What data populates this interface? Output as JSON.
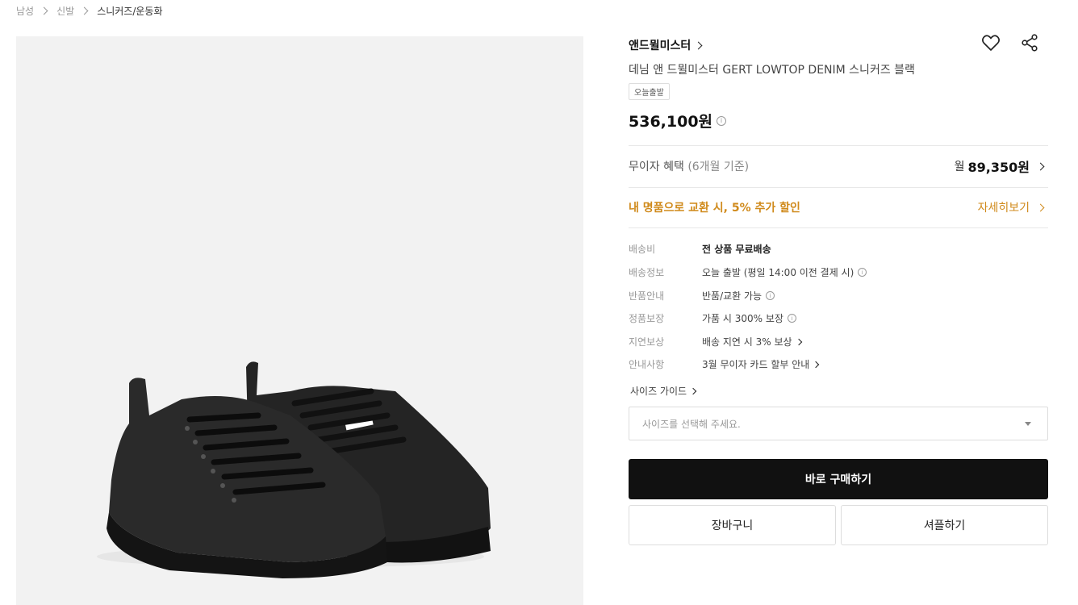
{
  "breadcrumb": {
    "items": [
      "남성",
      "신발",
      "스니커즈/운동화"
    ]
  },
  "product": {
    "brand": "앤드뮐미스터",
    "name": "데님 앤 드뮐미스터 GERT LOWTOP DENIM 스니커즈 블랙",
    "badge": "오늘출발",
    "price": "536,100원",
    "image_alt": "black lowtop sneakers"
  },
  "benefits": {
    "installment_label": "무이자 혜택",
    "installment_sub": "(6개월 기준)",
    "monthly_prefix": "월",
    "monthly_amount": "89,350원",
    "trade_text": "내 명품으로 교환 시, 5% 추가 할인",
    "detail_link": "자세히보기"
  },
  "specs": [
    {
      "label": "배송비",
      "value": "전 상품 무료배송"
    },
    {
      "label": "배송정보",
      "value": "오늘 출발 (평일 14:00 이전 결제 시)"
    },
    {
      "label": "반품안내",
      "value": "반품/교환 가능"
    },
    {
      "label": "정품보장",
      "value": "가품 시 300% 보장"
    },
    {
      "label": "지연보상",
      "value": "배송 지연 시 3% 보상"
    },
    {
      "label": "안내사항",
      "value": "3월 무이자 카드 할부 안내"
    }
  ],
  "size": {
    "guide_label": "사이즈 가이드",
    "placeholder": "사이즈를 선택해 주세요."
  },
  "actions": {
    "buy": "바로 구매하기",
    "cart": "장바구니",
    "share": "셔플하기"
  },
  "colors": {
    "accent": "#d08a1b",
    "primary_button": "#111111"
  }
}
